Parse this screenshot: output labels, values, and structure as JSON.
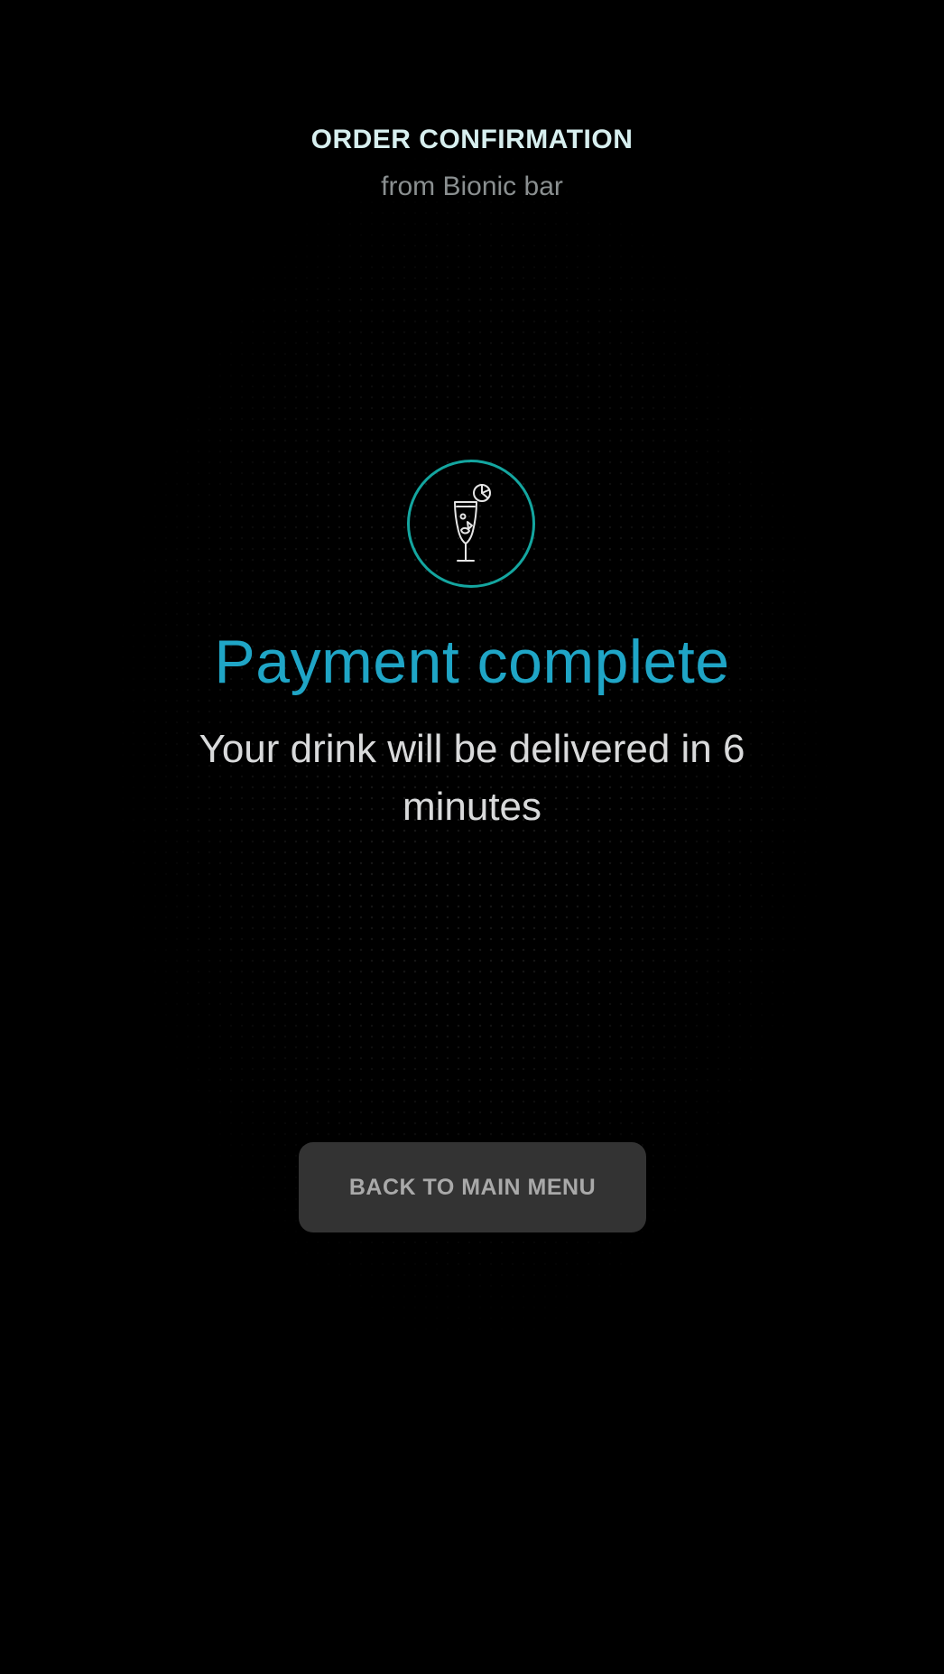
{
  "header": {
    "title": "ORDER CONFIRMATION",
    "subtitle": "from Bionic bar"
  },
  "status": {
    "icon": "cocktail-glass-icon",
    "title": "Payment complete",
    "message": "Your drink will be delivered in 6 minutes"
  },
  "actions": {
    "back_label": "BACK TO MAIN MENU"
  },
  "colors": {
    "background": "#000000",
    "accent_teal": "#14a6a0",
    "title_blue": "#1fa5c6",
    "button_bg": "#333333"
  }
}
